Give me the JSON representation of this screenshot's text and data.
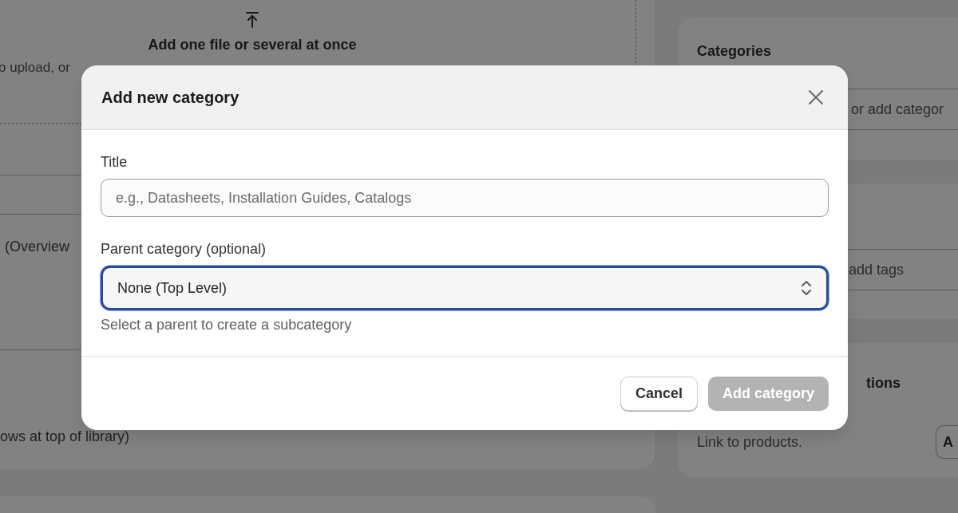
{
  "page": {
    "upload": {
      "heading": "Add one file or several at once",
      "hint": "o upload, or"
    },
    "left_rows": [
      "(Overview",
      "ows at top of library)"
    ],
    "categories_card": {
      "title": "Categories",
      "field_placeholder": "or add categor"
    },
    "tags_card": {
      "field_placeholder": "add tags"
    },
    "links_card": {
      "title": "tions",
      "text": "Link to products.",
      "button": "A"
    }
  },
  "dialog": {
    "title": "Add new category",
    "title_field": {
      "label": "Title",
      "placeholder": "e.g., Datasheets, Installation Guides, Catalogs"
    },
    "parent_field": {
      "label": "Parent category (optional)",
      "value": "None (Top Level)",
      "focused": true,
      "help": "Select a parent to create a subcategory"
    },
    "buttons": [
      {
        "label": "Cancel",
        "kind": "secondary",
        "disabled": false
      },
      {
        "label": "Add category",
        "kind": "primary",
        "disabled": true
      }
    ]
  }
}
